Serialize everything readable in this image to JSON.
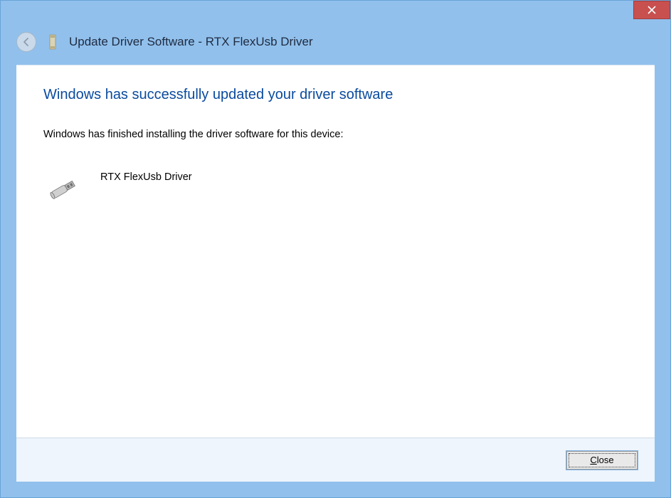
{
  "window": {
    "title": "Update Driver Software - RTX FlexUsb Driver"
  },
  "content": {
    "heading": "Windows has successfully updated your driver software",
    "body": "Windows has finished installing the driver software for this device:",
    "device_name": "RTX FlexUsb Driver"
  },
  "footer": {
    "close_label_prefix": "C",
    "close_label_rest": "lose"
  }
}
